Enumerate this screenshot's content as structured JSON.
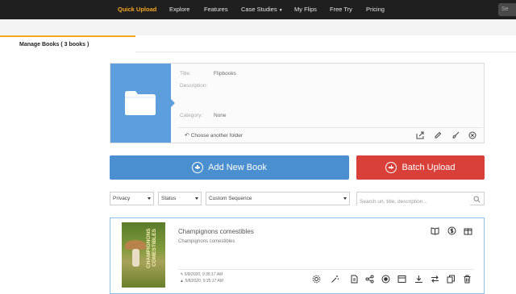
{
  "nav": {
    "items": [
      {
        "label": "Quick Upload",
        "active": true
      },
      {
        "label": "Explore"
      },
      {
        "label": "Features"
      },
      {
        "label": "Case Studies"
      },
      {
        "label": "My Flips"
      },
      {
        "label": "Free Try"
      },
      {
        "label": "Pricing"
      }
    ],
    "search_placeholder": "Se",
    "accent_color": "#f5a623"
  },
  "tabs": {
    "manage_books": "Manage Books ( 3 books )"
  },
  "folder": {
    "title_label": "Title:",
    "title_value": "Flipbooks",
    "description_label": "Description:",
    "category_label": "Category:",
    "category_value": "None",
    "choose_label": "Choose another folder"
  },
  "actions": {
    "add_book": "Add New Book",
    "batch_upload": "Batch Upload",
    "add_color": "#4a8fcf",
    "batch_color": "#d9403a"
  },
  "filters": {
    "privacy": "Privacy",
    "status": "Status",
    "sequence": "Custom Sequence",
    "search_placeholder": "Search url, title, description..."
  },
  "book": {
    "title": "Champignons comestibles",
    "description": "Champignons comestibles",
    "cover_text": "CHAMPIGNONS COMESTIBLES",
    "created": "5/8/2020, 9:35:17 AM",
    "modified": "5/8/2020, 9:35:17 AM"
  }
}
